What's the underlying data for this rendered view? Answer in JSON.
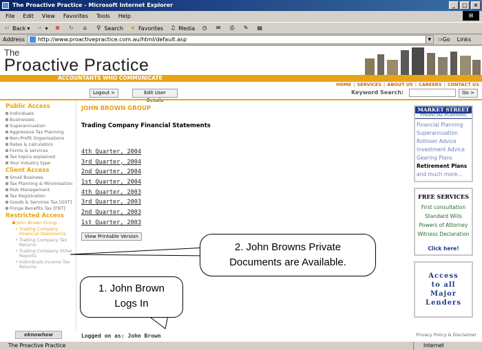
{
  "window": {
    "title": "The Proactive Practice - Microsoft Internet Explorer"
  },
  "menu": [
    "File",
    "Edit",
    "View",
    "Favorites",
    "Tools",
    "Help"
  ],
  "toolbar": {
    "back": "Back",
    "search": "Search",
    "favorites": "Favorites",
    "media": "Media"
  },
  "address": {
    "label": "Address",
    "url": "http://www.proactivepractice.com.au/html/default.asp",
    "go": "Go",
    "links": "Links"
  },
  "site": {
    "logo_small": "The",
    "logo_big": "Proactive Practice",
    "tagline": "ACCOUNTANTS WHO COMMUNICATE",
    "nav": [
      "HOME",
      "SERVICES",
      "ABOUT US",
      "CAREERS",
      "CONTACT US"
    ],
    "logout": "Logout >",
    "edit_user": "Edit User Details",
    "keyword_label": "Keyword Search:",
    "go": "Go >"
  },
  "leftnav": {
    "public_head": "Public Access",
    "public_items": [
      "Individuals",
      "Businesses",
      "Superannuation",
      "Aggressive Tax Planning",
      "Non-Profit Organisations",
      "Rates & calculators",
      "Forms & services",
      "Tax topics explained",
      "Your industry type"
    ],
    "client_head": "Client Access",
    "client_items": [
      "Small Business",
      "Tax Planning & Minimisation",
      "Risk Management",
      "Tax Registration",
      "Goods & Services Tax [GST]",
      "Fringe Benefits Tax [FBT]"
    ],
    "restricted_head": "Restricted Access",
    "restricted_user": "John Brown Group",
    "restricted_items": [
      "Trading Company Financial Statements",
      "Trading Company Tax Returns",
      "Trading Company Other Reports",
      "Individuals Income Tax Returns"
    ]
  },
  "content": {
    "group": "JOHN BROWN GROUP",
    "title": "Trading Company Financial Statements",
    "quarters": [
      "4th Quarter, 2004",
      "3rd Quarter, 2004",
      "2nd Quarter, 2004",
      "1st Quarter, 2004",
      "4th Quarter, 2003",
      "3rd Quarter, 2003",
      "2nd Quarter, 2003",
      "1st Quarter, 2003"
    ],
    "print_button": "View Printable Version"
  },
  "right": {
    "ms_head": "MARKET STREET",
    "ms_sub": "FINANCIAL PLANNING",
    "ms_items": [
      "Financial Planning",
      "Superannuation",
      "Rollover Advice",
      "Investment Advice",
      "Gearing Plans",
      "Retirement Plans",
      "and much more..."
    ],
    "fs_head": "FREE SERVICES",
    "fs_items": [
      "First consultation",
      "Standard Wills",
      "Powers of Attorney",
      "Witness Declaration"
    ],
    "fs_click": "Click here!",
    "access_lines": [
      "Access",
      "to all",
      "Major",
      "Lenders"
    ]
  },
  "footer": {
    "eknowhow": "eknowhow",
    "logged": "Logged on as: John Brown",
    "privacy": "Privacy Policy & Disclaimer"
  },
  "callouts": {
    "two_line1": "2.  John Browns Private",
    "two_line2": "Documents are Available.",
    "one_line1": "1. John Brown",
    "one_line2": "Logs In"
  },
  "status": {
    "left": "The Proactive Practice",
    "right": "Internet"
  }
}
